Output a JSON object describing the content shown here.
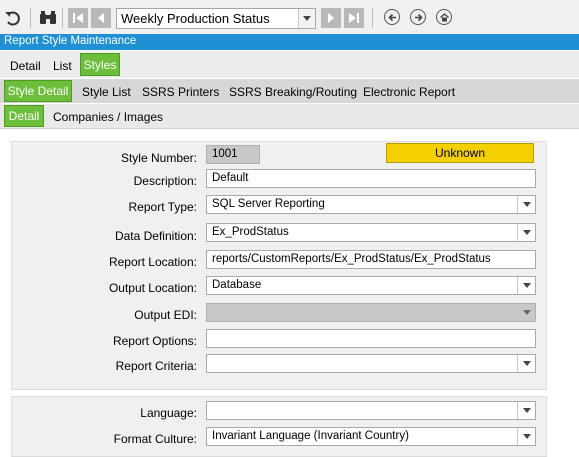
{
  "toolbar": {
    "search_value": "Weekly Production Status"
  },
  "window": {
    "title": "Report Style Maintenance"
  },
  "tabs_main": [
    {
      "label": "Detail"
    },
    {
      "label": "List"
    },
    {
      "label": "Styles"
    }
  ],
  "tabs_sub": [
    {
      "label": "Style Detail"
    },
    {
      "label": "Style List"
    },
    {
      "label": "SSRS Printers"
    },
    {
      "label": "SSRS Breaking/Routing"
    },
    {
      "label": "Electronic Report"
    }
  ],
  "tabs_detail": [
    {
      "label": "Detail"
    },
    {
      "label": "Companies / Images"
    }
  ],
  "form": {
    "style_number": {
      "label": "Style Number:",
      "value": "1001"
    },
    "status_label": "Unknown",
    "description": {
      "label": "Description:",
      "value": "Default"
    },
    "report_type": {
      "label": "Report Type:",
      "value": "SQL Server Reporting"
    },
    "data_definition": {
      "label": "Data Definition:",
      "value": "Ex_ProdStatus"
    },
    "report_location": {
      "label": "Report Location:",
      "value": "reports/CustomReports/Ex_ProdStatus/Ex_ProdStatus"
    },
    "output_location": {
      "label": "Output Location:",
      "value": "Database"
    },
    "output_edi": {
      "label": "Output EDI:",
      "value": ""
    },
    "report_options": {
      "label": "Report Options:",
      "value": ""
    },
    "report_criteria": {
      "label": "Report Criteria:",
      "value": ""
    },
    "language": {
      "label": "Language:",
      "value": ""
    },
    "format_culture": {
      "label": "Format Culture:",
      "value": "Invariant Language (Invariant Country)"
    }
  },
  "colors": {
    "accent_green": "#6cbf3a",
    "title_blue": "#1f8fd6",
    "status_yellow": "#f5d000"
  }
}
